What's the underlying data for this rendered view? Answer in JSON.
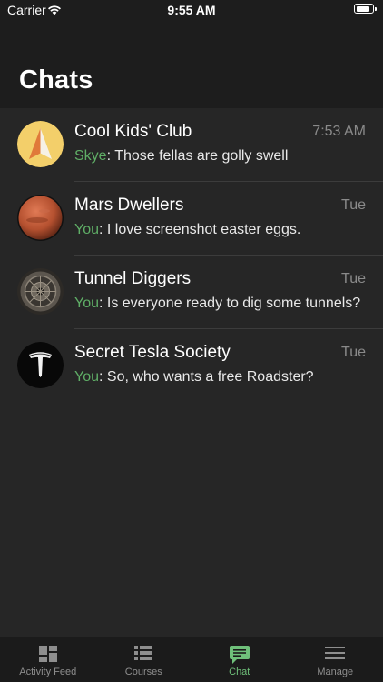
{
  "status_bar": {
    "carrier": "Carrier",
    "time": "9:55 AM"
  },
  "header": {
    "title": "Chats"
  },
  "chats": [
    {
      "name": "Cool Kids' Club",
      "time": "7:53 AM",
      "sender": "Skye",
      "message": "Those fellas are golly swell",
      "avatar": "pyramid-logo"
    },
    {
      "name": "Mars Dwellers",
      "time": "Tue",
      "sender": "You",
      "message": "I love screenshot easter eggs.",
      "avatar": "planet-mars"
    },
    {
      "name": "Tunnel Diggers",
      "time": "Tue",
      "sender": "You",
      "message": "Is everyone ready to dig some tunnels?",
      "avatar": "tunnel-boring-machine"
    },
    {
      "name": "Secret Tesla Society",
      "time": "Tue",
      "sender": "You",
      "message": "So, who wants a free Roadster?",
      "avatar": "tesla-logo"
    }
  ],
  "tab_bar": {
    "tabs": [
      {
        "label": "Activity Feed",
        "icon": "dashboard-icon",
        "active": false
      },
      {
        "label": "Courses",
        "icon": "list-icon",
        "active": false
      },
      {
        "label": "Chat",
        "icon": "chat-bubble-icon",
        "active": true
      },
      {
        "label": "Manage",
        "icon": "menu-icon",
        "active": false
      }
    ]
  },
  "colors": {
    "background": "#262626",
    "bar": "#1d1d1d",
    "accent": "#5fae66",
    "timestamp": "#8a8a8a"
  }
}
